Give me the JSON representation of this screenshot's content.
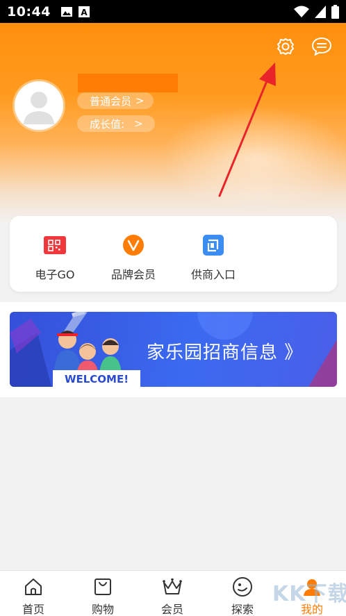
{
  "status_bar": {
    "time": "10:44"
  },
  "profile": {
    "member_level_label": "普通会员",
    "growth_label": "成长值:"
  },
  "shortcuts": [
    {
      "label": "电子GO",
      "icon": "qr-code-icon",
      "color": "#f0373c"
    },
    {
      "label": "品牌会员",
      "icon": "v-badge-icon",
      "color": "#ff7d04"
    },
    {
      "label": "供商入口",
      "icon": "supplier-entry-icon",
      "color": "#3b8df2"
    }
  ],
  "banner": {
    "title": "家乐园招商信息 》",
    "welcome_text": "WELCOME!"
  },
  "bottom_nav": [
    {
      "label": "首页",
      "icon": "home-icon"
    },
    {
      "label": "购物",
      "icon": "shopping-bag-icon"
    },
    {
      "label": "会员",
      "icon": "crown-icon"
    },
    {
      "label": "探索",
      "icon": "explore-icon"
    },
    {
      "label": "我的",
      "icon": "profile-icon",
      "active": true
    }
  ],
  "colors": {
    "accent": "#ff7d04",
    "header_orange": "#ff8f0d",
    "banner_blue": "#3b6af0",
    "arrow_red": "#e8242a"
  },
  "watermark": "KK下载"
}
